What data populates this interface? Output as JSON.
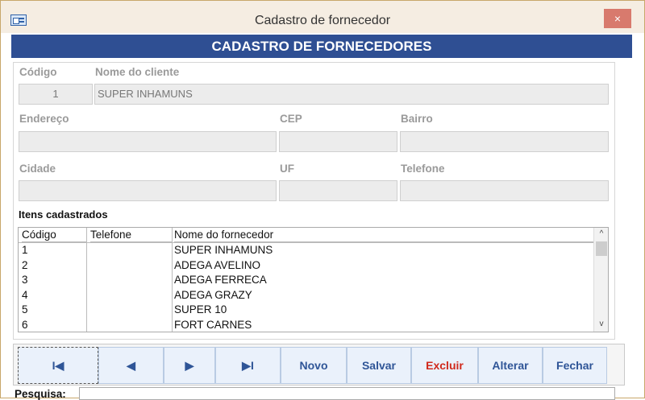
{
  "window": {
    "title": "Cadastro de fornecedor",
    "close_glyph": "×"
  },
  "header": {
    "title": "CADASTRO DE FORNECEDORES"
  },
  "form": {
    "codigo_label": "Código",
    "codigo_value": "1",
    "nome_label": "Nome do cliente",
    "nome_value": "SUPER INHAMUNS",
    "endereco_label": "Endereço",
    "endereco_value": "",
    "cep_label": "CEP",
    "cep_value": "",
    "bairro_label": "Bairro",
    "bairro_value": "",
    "cidade_label": "Cidade",
    "cidade_value": "",
    "uf_label": "UF",
    "uf_value": "",
    "telefone_label": "Telefone",
    "telefone_value": ""
  },
  "list": {
    "section_label": "Itens cadastrados",
    "columns": [
      "Código",
      "Telefone",
      "Nome do fornecedor"
    ],
    "rows": [
      {
        "codigo": "1",
        "telefone": "",
        "nome": "SUPER INHAMUNS"
      },
      {
        "codigo": "2",
        "telefone": "",
        "nome": "ADEGA AVELINO"
      },
      {
        "codigo": "3",
        "telefone": "",
        "nome": "ADEGA FERRECA"
      },
      {
        "codigo": "4",
        "telefone": "",
        "nome": "ADEGA GRAZY"
      },
      {
        "codigo": "5",
        "telefone": "",
        "nome": "SUPER 10"
      },
      {
        "codigo": "6",
        "telefone": "",
        "nome": "FORT CARNES"
      }
    ],
    "scroll_up": "^",
    "scroll_down": "v"
  },
  "toolbar": {
    "first": "I◀",
    "prev": "◀",
    "next": "▶",
    "last": "▶I",
    "novo": "Novo",
    "salvar": "Salvar",
    "excluir": "Excluir",
    "alterar": "Alterar",
    "fechar": "Fechar"
  },
  "search": {
    "label": "Pesquisa:",
    "value": ""
  },
  "colors": {
    "header": "#2f4f93",
    "button_text": "#2f5597",
    "delete_text": "#d0291c"
  },
  "icons": {
    "app": "form-window-icon"
  }
}
